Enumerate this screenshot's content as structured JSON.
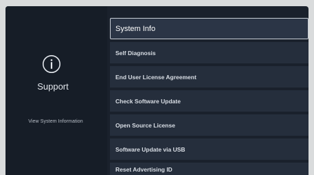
{
  "left_panel": {
    "icon": "info-circle-icon",
    "title": "Support",
    "description": "View System Information"
  },
  "menu": {
    "items": [
      {
        "label": "System Info",
        "selected": true
      },
      {
        "label": "Self Diagnosis",
        "selected": false
      },
      {
        "label": "End User License Agreement",
        "selected": false
      },
      {
        "label": "Check Software Update",
        "selected": false
      },
      {
        "label": "Open Source License",
        "selected": false
      },
      {
        "label": "Software Update via USB",
        "selected": false
      },
      {
        "label": "Reset Advertising ID",
        "selected": false
      }
    ]
  },
  "colors": {
    "background": "#1a212c",
    "item_background": "#252e3c",
    "selected_border": "#c8ced6",
    "text": "#d9dee5"
  }
}
